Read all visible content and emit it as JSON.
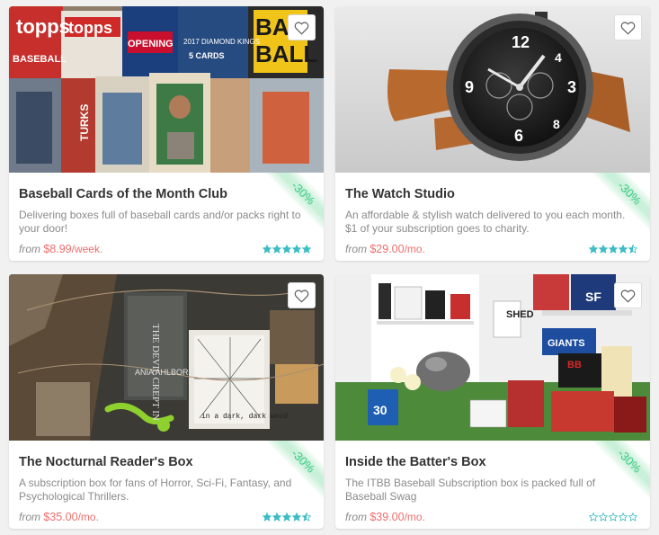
{
  "products": [
    {
      "title": "Baseball Cards of the Month Club",
      "description": "Delivering boxes full of baseball cards and/or packs right to your door!",
      "price_from": "from",
      "price": "$8.99",
      "period": "/week.",
      "discount": "-30%",
      "rating": 5,
      "image_icon": "baseball-cards-photo",
      "image_text": [
        "topps",
        "topps",
        "BASEBALL",
        "OPENING",
        "2017 DIAMOND KINGS",
        "5 CARDS",
        "BAS",
        "BALL",
        "TURKS"
      ]
    },
    {
      "title": "The Watch Studio",
      "description": "An affordable & stylish watch delivered to you each month. $1 of your subscription goes to charity.",
      "price_from": "from",
      "price": "$29.00",
      "period": "/mo.",
      "discount": "-30%",
      "rating": 4.5,
      "image_icon": "wristwatch-photo",
      "image_text": [
        "12",
        "3",
        "9",
        "6",
        "4",
        "8"
      ]
    },
    {
      "title": "The Nocturnal Reader's Box",
      "description": "A subscription box for fans of Horror, Sci-Fi, Fantasy, and Psychological Thrillers.",
      "price_from": "from",
      "price": "$35.00",
      "period": "/mo.",
      "discount": "-30%",
      "rating": 4.5,
      "image_icon": "books-box-photo",
      "image_text": [
        "THE DEVIL CREPT IN",
        "ANIA AHLBORN",
        "in a dark, dark wood"
      ]
    },
    {
      "title": "Inside the Batter's Box",
      "description": "The ITBB Baseball Subscription box is packed full of Baseball Swag",
      "price_from": "from",
      "price": "$39.00",
      "period": "/mo.",
      "discount": "-30%",
      "rating": 0,
      "image_icon": "baseball-gear-photo",
      "image_text": [
        "SHED",
        "GIANTS",
        "SF",
        "30",
        "BB"
      ]
    }
  ],
  "colors": {
    "price": "#ef6f6c",
    "star": "#3cbcc4",
    "discount": "#38c987",
    "discount_bg": "#c9f0d8",
    "title": "#333333",
    "text": "#8b8b8b"
  }
}
